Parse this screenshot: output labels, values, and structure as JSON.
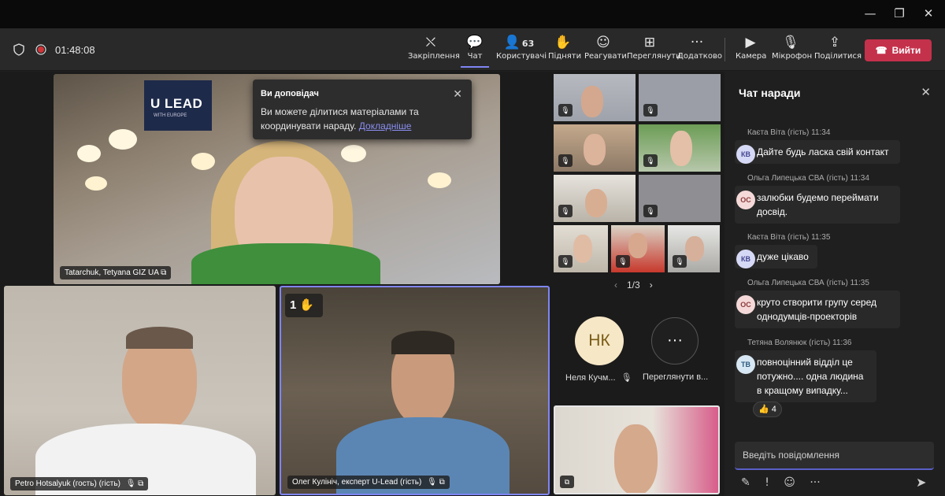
{
  "toolbar": {
    "timer": "01:48:08",
    "items": [
      {
        "label": "Закріплення",
        "icon": "pin-off-icon"
      },
      {
        "label": "Чат",
        "icon": "chat-icon"
      },
      {
        "label": "Користувачі",
        "icon": "people-icon",
        "count": "63"
      },
      {
        "label": "Підняти",
        "icon": "raise-hand-icon"
      },
      {
        "label": "Реагувати",
        "icon": "react-icon"
      },
      {
        "label": "Переглянути",
        "icon": "view-icon"
      },
      {
        "label": "Додатково",
        "icon": "more-icon"
      },
      {
        "label": "Камера",
        "icon": "camera-icon"
      },
      {
        "label": "Мікрофон",
        "icon": "microphone-icon"
      },
      {
        "label": "Поділитися",
        "icon": "share-icon"
      }
    ],
    "leave_label": "Вийти"
  },
  "tooltip": {
    "title": "Ви доповідач",
    "text": "Ви можете ділитися матеріалами та координувати нараду.",
    "link": "Докладніше"
  },
  "stage": {
    "presenter_name": "Tatarchuk, Tetyana GIZ UA",
    "logo_main": "U LEAD",
    "logo_sub": "WITH EUROPE",
    "bottom_left_name": "Petro Hotsalyuk (гость) (гість)",
    "bottom_mid_name": "Олег Кулініч, експерт U-Lead (гість)",
    "hand_count": "1",
    "pagination": "1/3",
    "nk_initials": "НК",
    "nk_name": "Неля Кучм...",
    "more_label": "Переглянути в..."
  },
  "chat": {
    "title": "Чат наради",
    "messages": [
      {
        "author": "Каєта Віта (гість)",
        "time": "11:34",
        "initials": "КВ",
        "text": "Дайте будь ласка свій контакт"
      },
      {
        "author": "Ольга Липецька СВА (гість)",
        "time": "11:34",
        "initials": "ОС",
        "text": "залюбки будемо переймати досвід."
      },
      {
        "author": "Каєта Віта (гість)",
        "time": "11:35",
        "initials": "КВ",
        "text": "дуже цікаво"
      },
      {
        "author": "Ольга Липецька СВА (гість)",
        "time": "11:35",
        "initials": "ОС",
        "text": "круто створити групу серед однодумців-проекторів"
      },
      {
        "author": "Тетяна Волянюк (гість)",
        "time": "11:36",
        "initials": "ТВ",
        "text": "повноцінний відділ це потужно.... одна людина в кращому випадку..."
      }
    ],
    "reaction_count": "4",
    "compose_placeholder": "Введіть повідомлення"
  }
}
